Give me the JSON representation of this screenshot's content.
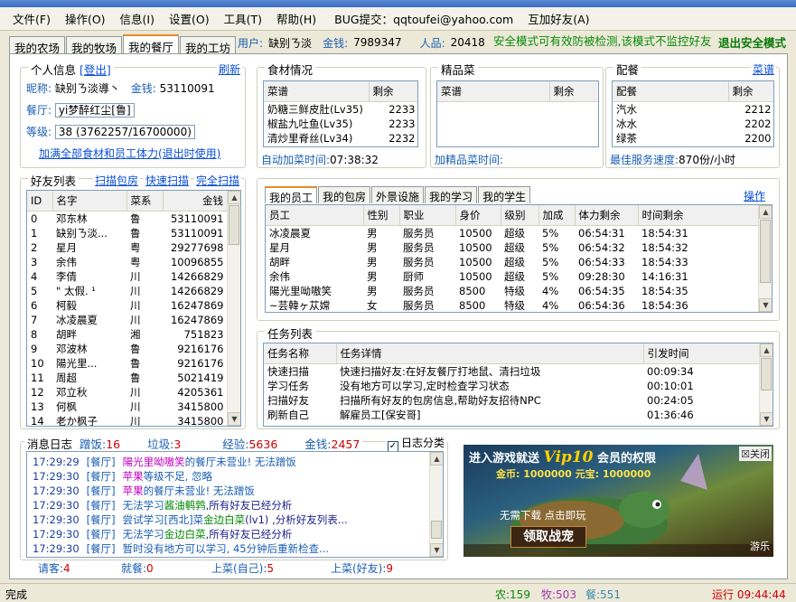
{
  "menu": [
    "文件(F)",
    "操作(O)",
    "信息(I)",
    "设置(O)",
    "工具(T)",
    "帮助(H)"
  ],
  "bug": {
    "label": "BUG提交：",
    "email": "qqtoufei@yahoo.com"
  },
  "mutual": "互加好友(A)",
  "tabs": [
    "我的农场",
    "我的牧场",
    "我的餐厅",
    "我的工坊"
  ],
  "userbar": {
    "user_label": "用户:",
    "user": "缺别ㄋ淡",
    "money_label": "金钱:",
    "money": "7989347",
    "pop_label": "人品:",
    "pop": "20418"
  },
  "safe_text": "安全模式可有效防被检测,该模式不监控好友",
  "exit_safe": "退出安全模式",
  "personal": {
    "title": "个人信息",
    "logout": "[登出]",
    "refresh": "刷新",
    "nick_label": "昵称:",
    "nick": "缺别ㄋ淡導丶",
    "money_label": "金钱:",
    "money": "53110091",
    "rest_label": "餐厅:",
    "rest": "yi梦醉红尘[鲁]",
    "level_label": "等级:",
    "level": "38 (3762257/16700000)",
    "addall": "加满全部食材和员工体力(退出时使用)"
  },
  "food": {
    "title": "食材情况",
    "cols": [
      "菜谱",
      "剩余"
    ],
    "rows": [
      [
        "奶糖三鲜皮肚(Lv35)",
        "2233"
      ],
      [
        "椒盐九吐鱼(Lv35)",
        "2233"
      ],
      [
        "清炒里脊丝(Lv34)",
        "2232"
      ]
    ],
    "auto_label": "自动加菜时间:",
    "auto": "07:38:32"
  },
  "fine": {
    "title": "精品菜",
    "cols": [
      "菜谱",
      "剩余"
    ],
    "time_label": "加精品菜时间:"
  },
  "side": {
    "title": "配餐",
    "link": "菜谱",
    "cols": [
      "配餐",
      "剩余"
    ],
    "rows": [
      [
        "汽水",
        "2212"
      ],
      [
        "冰水",
        "2202"
      ],
      [
        "绿茶",
        "2200"
      ]
    ],
    "speed_label": "最佳服务速度:",
    "speed": "870份/小时"
  },
  "friends": {
    "title": "好友列表",
    "scan": "扫描包房",
    "quick": "快速扫描",
    "full": "完全扫描",
    "cols": [
      "ID",
      "名字",
      "菜系",
      "金钱"
    ],
    "rows": [
      [
        "0",
        "邓东林",
        "鲁",
        "53110091"
      ],
      [
        "1",
        "缺别ㄋ淡...",
        "鲁",
        "53110091"
      ],
      [
        "2",
        "星月",
        "粤",
        "29277698"
      ],
      [
        "3",
        "余伟",
        "粤",
        "10096855"
      ],
      [
        "4",
        "李倩",
        "川",
        "14266829"
      ],
      [
        "5",
        "\" 太假. ¹",
        "川",
        "14266829"
      ],
      [
        "6",
        "柯毅",
        "川",
        "16247869"
      ],
      [
        "7",
        "冰凌晨夏",
        "川",
        "16247869"
      ],
      [
        "8",
        "胡畔",
        "湘",
        "751823"
      ],
      [
        "9",
        "邓波林",
        "鲁",
        "9216176"
      ],
      [
        "10",
        "陽光里...",
        "鲁",
        "9216176"
      ],
      [
        "11",
        "周超",
        "鲁",
        "5021419"
      ],
      [
        "12",
        "邓立秋",
        "川",
        "4205361"
      ],
      [
        "13",
        "何枫",
        "川",
        "3415800"
      ],
      [
        "14",
        "老か枫子",
        "川",
        "3415800"
      ]
    ]
  },
  "innertabs": [
    "我的员工",
    "我的包房",
    "外景设施",
    "我的学习",
    "我的学生"
  ],
  "operate": "操作",
  "staff": {
    "cols": [
      "员工",
      "性别",
      "职业",
      "身价",
      "级别",
      "加成",
      "体力剩余",
      "时间剩余"
    ],
    "rows": [
      [
        "冰凌晨夏",
        "男",
        "服务员",
        "10500",
        "超级",
        "5%",
        "06:54:31",
        "18:54:31"
      ],
      [
        "星月",
        "男",
        "服务员",
        "10500",
        "超级",
        "5%",
        "06:54:32",
        "18:54:32"
      ],
      [
        "胡畔",
        "男",
        "服务员",
        "10500",
        "超级",
        "5%",
        "06:54:33",
        "18:54:33"
      ],
      [
        "余伟",
        "男",
        "厨师",
        "10500",
        "超级",
        "5%",
        "09:28:30",
        "14:16:31"
      ],
      [
        "陽光里呦嗷笑",
        "男",
        "服务员",
        "8500",
        "特级",
        "4%",
        "06:54:35",
        "18:54:35"
      ],
      [
        "~芸韓ヶ苁嫦",
        "女",
        "服务员",
        "8500",
        "特级",
        "4%",
        "06:54:36",
        "18:54:36"
      ]
    ]
  },
  "tasks": {
    "title": "任务列表",
    "cols": [
      "任务名称",
      "任务详情",
      "引发时间"
    ],
    "rows": [
      [
        "快速扫描",
        "快速扫描好友:在好友餐厅打地鼠、清扫垃圾",
        "00:09:34"
      ],
      [
        "学习任务",
        "没有地方可以学习,定时检查学习状态",
        "00:10:01"
      ],
      [
        "扫描好友",
        "扫描所有好友的包房信息,帮助好友招待NPC",
        "00:24:05"
      ],
      [
        "刷新自己",
        "解雇员工[保安哥]",
        "01:36:46"
      ]
    ]
  },
  "log": {
    "title": "消息日志",
    "stats": [
      [
        "蹭饭:",
        "16"
      ],
      [
        "垃圾:",
        "3"
      ],
      [
        "经验:",
        "5636"
      ],
      [
        "金钱:",
        "2457"
      ]
    ],
    "classify": "日志分类",
    "lines": [
      {
        "time": "17:29:29",
        "cat": "[餐厅]",
        "name": "陽光里呦嗷笑",
        "msg": "的餐厅未营业! 无法蹭饭"
      },
      {
        "time": "17:29:30",
        "cat": "[餐厅]",
        "name": "苹果",
        "msg": "等级不足, 忽略"
      },
      {
        "time": "17:29:30",
        "cat": "[餐厅]",
        "name": "苹果",
        "msg": "的餐厅未营业! 无法蹭饭"
      },
      {
        "time": "17:29:30",
        "cat": "[餐厅]",
        "name": "",
        "msg": "无法学习",
        "green": "酱油鹌鹑",
        "tail": ",所有好友已经分析"
      },
      {
        "time": "17:29:30",
        "cat": "[餐厅]",
        "name": "",
        "msg": "尝试学习[西北]菜",
        "green": "金边白菜",
        "tail": "(lv1) ,分析好友列表..."
      },
      {
        "time": "17:29:30",
        "cat": "[餐厅]",
        "name": "",
        "msg": "无法学习",
        "green": "金边白菜",
        "tail": ",所有好友已经分析"
      },
      {
        "time": "17:29:30",
        "cat": "[餐厅]",
        "name": "",
        "msg": "暂时没有地方可以学习, 45分钟后重新检查..."
      }
    ]
  },
  "bottomcounts": [
    [
      "请客:",
      "4"
    ],
    [
      "就餐:",
      "0"
    ],
    [
      "上菜(自己):",
      "5"
    ],
    [
      "上菜(好友):",
      "9"
    ]
  ],
  "ad": {
    "line1": "进入游戏就送",
    "vip": "Vip10",
    "line1b": "会员的权限",
    "gold": "金币: 1000000 元宝: 1000000",
    "nodl": "无需下载 点击即玩",
    "cta": "领取战宠",
    "close": "关闭",
    "brand": "游乐"
  },
  "status": {
    "text": "完成",
    "farm": "农:159",
    "ranch": "牧:503",
    "rest": "餐:551",
    "run": "运行 09:44:44"
  }
}
